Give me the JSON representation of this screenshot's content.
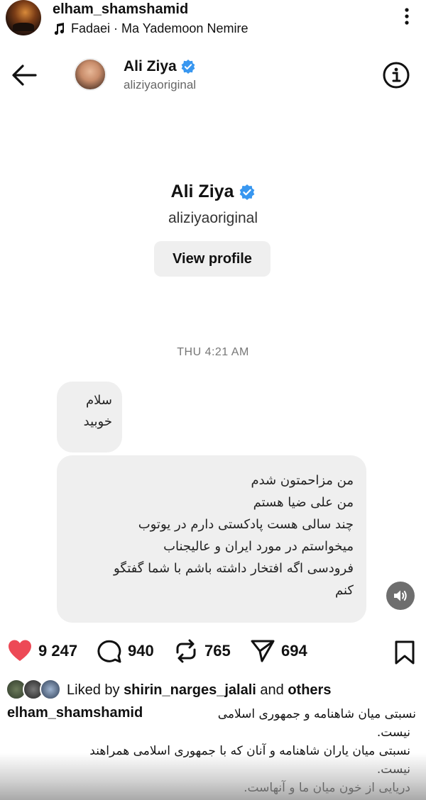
{
  "post": {
    "username": "elham_shamshamid",
    "audio": "Fadaei · Ma Yademoon Nemire"
  },
  "dm": {
    "name": "Ali Ziya",
    "handle": "aliziyaoriginal",
    "profile_name": "Ali Ziya",
    "profile_handle": "aliziyaoriginal",
    "view_profile_label": "View profile",
    "timestamp": "THU 4:21 AM",
    "messages": [
      {
        "lines": [
          "سلام",
          "خوبید"
        ]
      },
      {
        "lines": [
          "من مزاحمتون شدم",
          "من علی ضیا هستم",
          "چند سالی هست پادکستی دارم در یوتوب",
          "میخواستم در مورد ایران و عالیجناب",
          "فرودسی اگه افتخار داشته باشم با شما گفتگو",
          "کنم"
        ]
      }
    ],
    "colors": {
      "verified": "#3897f0",
      "bubble": "#efefef"
    }
  },
  "actions": {
    "likes": "9 247",
    "comments": "940",
    "reposts": "765",
    "shares": "694",
    "like_color": "#ed4956"
  },
  "liked_by": {
    "prefix": "Liked by",
    "user": "shirin_narges_jalali",
    "and": "and",
    "others": "others"
  },
  "caption": {
    "username": "elham_shamshamid",
    "lines": [
      "نسبتی میان شاهنامه و جمهوری اسلامی",
      "نیست.",
      "نسبتی میان یاران شاهنامه و آنان که با جمهوری اسلامی همراهند",
      "نیست.",
      "دریایی از خون میان ما و آنهاست."
    ]
  },
  "icons": [
    "music-icon",
    "more-icon",
    "back-icon",
    "verified-icon",
    "info-icon",
    "speaker-icon",
    "heart-icon",
    "comment-icon",
    "repost-icon",
    "share-icon",
    "bookmark-icon"
  ]
}
